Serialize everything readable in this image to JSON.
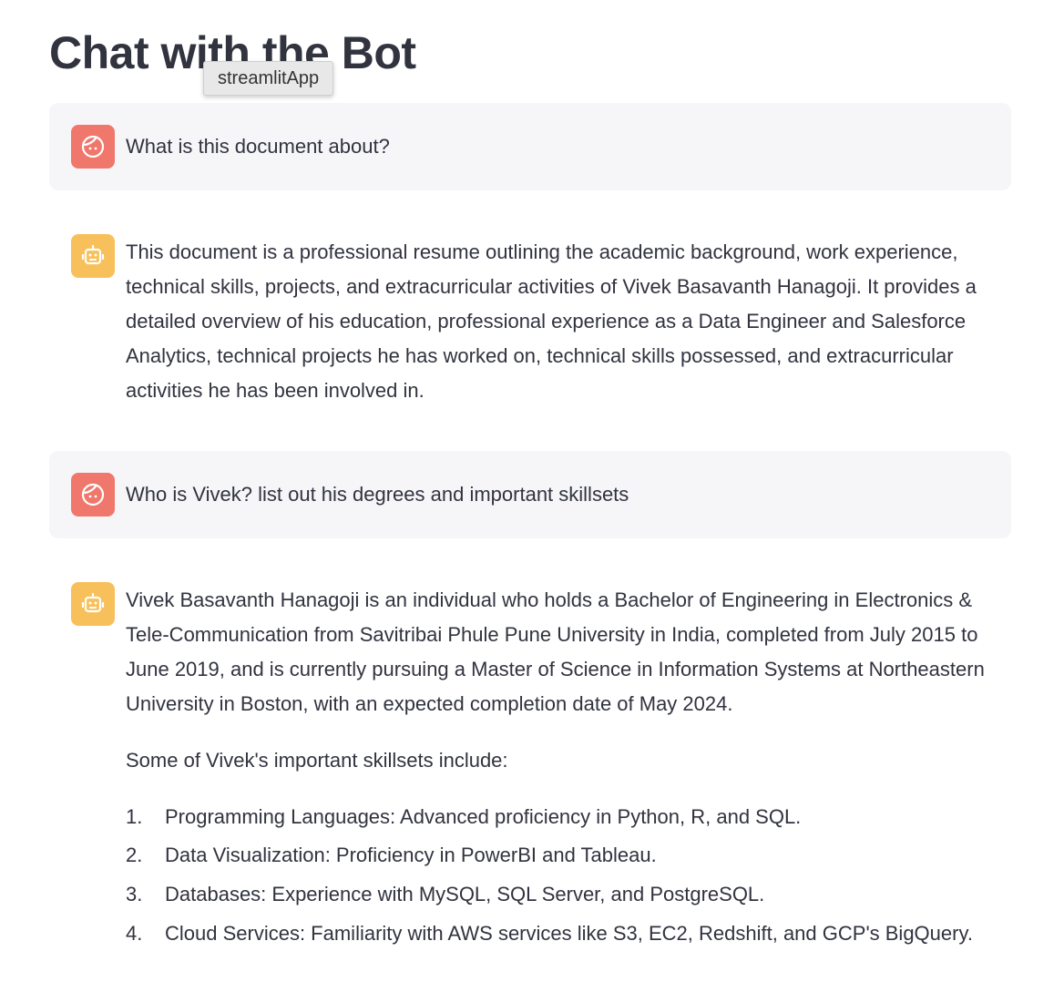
{
  "page": {
    "title": "Chat with the Bot",
    "tooltip": "streamlitApp"
  },
  "icons": {
    "user_avatar": "user-face-icon",
    "bot_avatar": "robot-face-icon",
    "user_color": "#f0776b",
    "bot_color": "#f8c05a"
  },
  "messages": [
    {
      "role": "user",
      "text": "What is this document about?"
    },
    {
      "role": "assistant",
      "lines": [
        "This document is a professional resume outlining the academic background, work experience,",
        "technical skills, projects, and extracurricular activities of Vivek Basavanth Hanagoji. It provides a",
        "detailed overview of his education, professional experience as a Data Engineer and Salesforce",
        "Analytics, technical projects he has worked on, technical skills possessed, and extracurricular",
        "activities he has been involved in."
      ]
    },
    {
      "role": "user",
      "text": "Who is Vivek? list out his degrees and important skillsets"
    },
    {
      "role": "assistant",
      "lines": [
        "Vivek Basavanth Hanagoji is an individual who holds a Bachelor of Engineering in Electronics &",
        "Tele-Communication from Savitribai Phule Pune University in India, completed from July 2015 to",
        "June 2019, and is currently pursuing a Master of Science in Information Systems at Northeastern",
        "University in Boston, with an expected completion date of May 2024."
      ],
      "intro": "Some of Vivek's important skillsets include:",
      "list": [
        {
          "num": "1.",
          "text": "Programming Languages: Advanced proficiency in Python, R, and SQL."
        },
        {
          "num": "2.",
          "text": "Data Visualization: Proficiency in PowerBI and Tableau."
        },
        {
          "num": "3.",
          "text": "Databases: Experience with MySQL, SQL Server, and PostgreSQL."
        },
        {
          "num": "4.",
          "text": "Cloud Services: Familiarity with AWS services like S3, EC2, Redshift, and GCP's BigQuery."
        }
      ]
    }
  ]
}
